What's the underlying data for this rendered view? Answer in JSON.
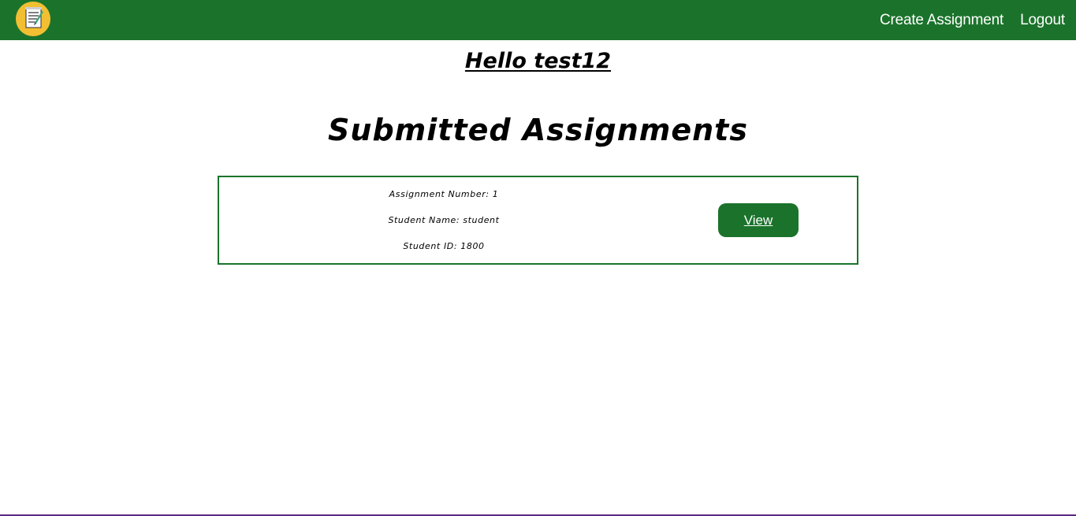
{
  "navbar": {
    "logo_icon": "assignment-checklist-icon",
    "links": {
      "create_assignment": "Create Assignment",
      "logout": "Logout"
    },
    "background": "#1b732b"
  },
  "greeting": "Hello test12",
  "page_title": "Submitted Assignments",
  "submissions": [
    {
      "assignment_number": "Assignment Number: 1",
      "student_name": "Student Name: student",
      "student_id": "Student ID: 1800",
      "view_label": "View"
    }
  ],
  "colors": {
    "accent": "#1b732b",
    "logo_circle": "#f2bf32"
  }
}
